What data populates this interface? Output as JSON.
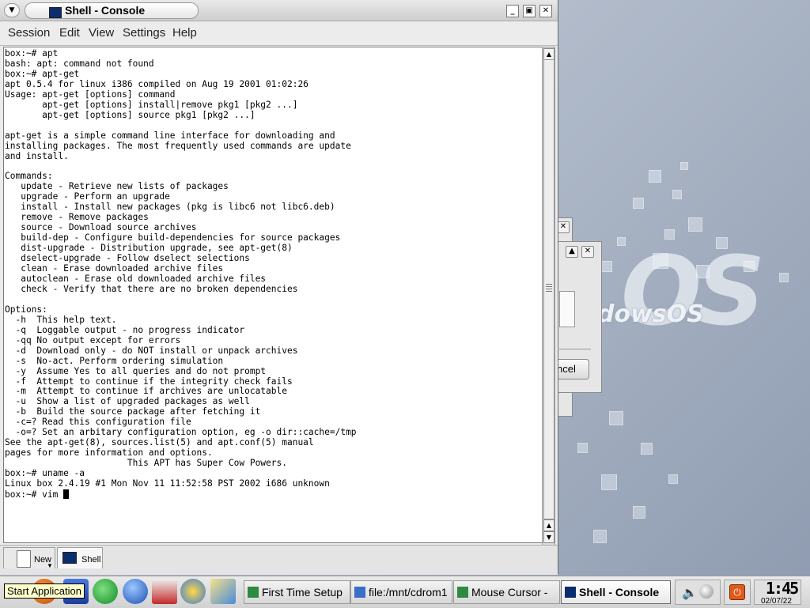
{
  "window": {
    "title": "Shell - Console",
    "menu": [
      "Session",
      "Edit",
      "View",
      "Settings",
      "Help"
    ]
  },
  "terminal": {
    "lines": [
      "box:~# apt",
      "bash: apt: command not found",
      "box:~# apt-get",
      "apt 0.5.4 for linux i386 compiled on Aug 19 2001 01:02:26",
      "Usage: apt-get [options] command",
      "       apt-get [options] install|remove pkg1 [pkg2 ...]",
      "       apt-get [options] source pkg1 [pkg2 ...]",
      "",
      "apt-get is a simple command line interface for downloading and",
      "installing packages. The most frequently used commands are update",
      "and install.",
      "",
      "Commands:",
      "   update - Retrieve new lists of packages",
      "   upgrade - Perform an upgrade",
      "   install - Install new packages (pkg is libc6 not libc6.deb)",
      "   remove - Remove packages",
      "   source - Download source archives",
      "   build-dep - Configure build-dependencies for source packages",
      "   dist-upgrade - Distribution upgrade, see apt-get(8)",
      "   dselect-upgrade - Follow dselect selections",
      "   clean - Erase downloaded archive files",
      "   autoclean - Erase old downloaded archive files",
      "   check - Verify that there are no broken dependencies",
      "",
      "Options:",
      "  -h  This help text.",
      "  -q  Loggable output - no progress indicator",
      "  -qq No output except for errors",
      "  -d  Download only - do NOT install or unpack archives",
      "  -s  No-act. Perform ordering simulation",
      "  -y  Assume Yes to all queries and do not prompt",
      "  -f  Attempt to continue if the integrity check fails",
      "  -m  Attempt to continue if archives are unlocatable",
      "  -u  Show a list of upgraded packages as well",
      "  -b  Build the source package after fetching it",
      "  -c=? Read this configuration file",
      "  -o=? Set an arbitary configuration option, eg -o dir::cache=/tmp",
      "See the apt-get(8), sources.list(5) and apt.conf(5) manual",
      "pages for more information and options.",
      "                       This APT has Super Cow Powers.",
      "box:~# uname -a",
      "Linux box 2.4.19 #1 Mon Nov 11 11:52:58 PST 2002 i686 unknown"
    ],
    "prompt": "box:~# vim "
  },
  "tabs": [
    {
      "label": "New"
    },
    {
      "label": "Shell"
    }
  ],
  "desktop": {
    "logo_text": "dowsOS",
    "dialog_button": "ncel"
  },
  "taskbar": {
    "tooltip": "Start Application",
    "tasks": [
      "First Time Setup",
      "file:/mnt/cdrom1",
      "Mouse Cursor -",
      "Shell - Console"
    ],
    "clock_time": "1:45",
    "clock_date": "02/07/22"
  },
  "colors": {
    "terminal_bg": "#ffffff",
    "title_icon": "#0a2d6e"
  }
}
